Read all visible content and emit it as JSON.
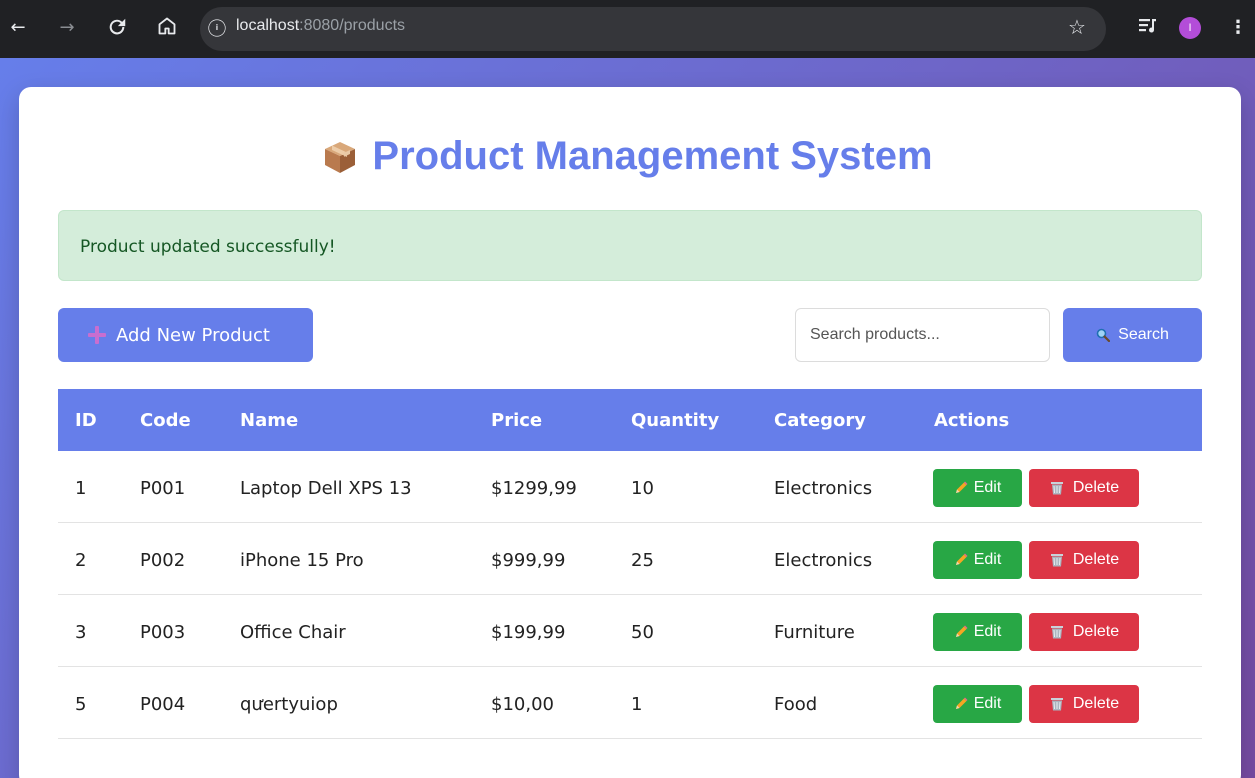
{
  "browser": {
    "url_host": "localhost",
    "url_rest": ":8080/products",
    "avatar_letter": "I",
    "icons": [
      "back-icon",
      "forward-icon",
      "reload-icon",
      "home-icon",
      "info-icon",
      "star-icon",
      "extensions-icon",
      "menu-icon"
    ]
  },
  "page": {
    "title": "Product Management System",
    "title_icon": "package-icon",
    "accent_color": "#667eea"
  },
  "alert": {
    "message": "Product updated successfully!",
    "color": "#155724",
    "background": "#d4edda"
  },
  "toolbar": {
    "add_label": "Add New Product",
    "search_placeholder": "Search products...",
    "search_value": "",
    "search_label": "Search"
  },
  "table": {
    "headers": [
      "ID",
      "Code",
      "Name",
      "Price",
      "Quantity",
      "Category",
      "Actions"
    ],
    "rows": [
      {
        "id": "1",
        "code": "P001",
        "name": "Laptop Dell XPS 13",
        "price": "$1299,99",
        "quantity": "10",
        "category": "Electronics"
      },
      {
        "id": "2",
        "code": "P002",
        "name": "iPhone 15 Pro",
        "price": "$999,99",
        "quantity": "25",
        "category": "Electronics"
      },
      {
        "id": "3",
        "code": "P003",
        "name": "Office Chair",
        "price": "$199,99",
        "quantity": "50",
        "category": "Furniture"
      },
      {
        "id": "5",
        "code": "P004",
        "name": "qưertyuiop",
        "price": "$10,00",
        "quantity": "1",
        "category": "Food"
      }
    ],
    "edit_label": "Edit",
    "delete_label": "Delete",
    "edit_color": "#28a745",
    "delete_color": "#dc3545"
  }
}
